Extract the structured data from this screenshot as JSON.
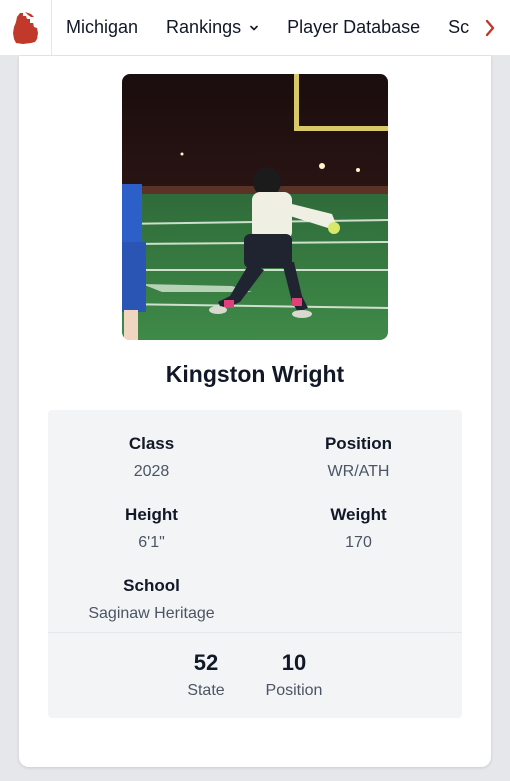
{
  "nav": {
    "logo_icon": "michigan-state-icon",
    "items": [
      {
        "label": "Michigan",
        "has_dropdown": false
      },
      {
        "label": "Rankings",
        "has_dropdown": true
      },
      {
        "label": "Player Database",
        "has_dropdown": false
      },
      {
        "label": "Sc",
        "has_dropdown": false
      }
    ],
    "scroll_icon": "chevron-right-icon",
    "accent_color": "#c0392b"
  },
  "player": {
    "name": "Kingston Wright",
    "photo_icon": "football-player-photo"
  },
  "details": {
    "class_label": "Class",
    "class_value": "2028",
    "position_label": "Position",
    "position_value": "WR/ATH",
    "height_label": "Height",
    "height_value": "6'1\"",
    "weight_label": "Weight",
    "weight_value": "170",
    "school_label": "School",
    "school_value": "Saginaw Heritage"
  },
  "rankings": {
    "state_value": "52",
    "state_label": "State",
    "position_value": "10",
    "position_label": "Position"
  }
}
